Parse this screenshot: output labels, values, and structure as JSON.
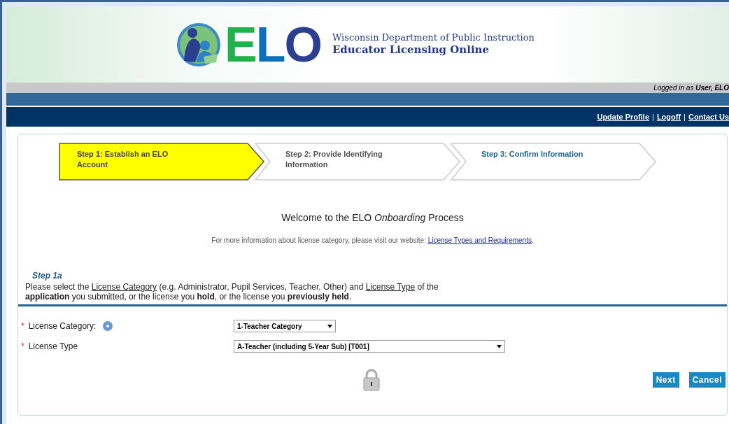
{
  "header": {
    "logo_text": "ELO",
    "org": "Wisconsin Department of Public Instruction",
    "app": "Educator Licensing Online"
  },
  "user_bar": {
    "text": "Logged in as **User, ELO**"
  },
  "nav_links": [
    {
      "label": "Update Profile"
    },
    {
      "label": "Logoff"
    },
    {
      "label": "Contact Us"
    }
  ],
  "nav_separator": "|",
  "steps": [
    {
      "label": "Step 1: Establish an ELO Account",
      "selected": true
    },
    {
      "label": "Step 2: Provide Identifying Information",
      "selected": false
    },
    {
      "label": "Step 3: Confirm Information",
      "selected": false
    }
  ],
  "welcome": "Welcome to the ELO *Onboarding* Process",
  "info": {
    "text": "For more information about license category, please visit our website: ",
    "link": "License Types and Requirements",
    "end": "."
  },
  "step_heading": "Step 1a",
  "instructions": [
    {
      "kind": "plain",
      "text": "Please select the "
    },
    {
      "kind": "underline",
      "text": "License Category"
    },
    {
      "kind": "plain",
      "text": " (e.g. Administrator, Pupil Services, Teacher, Other) and "
    },
    {
      "kind": "underline",
      "text": "License Type"
    },
    {
      "kind": "plain",
      "text": " of the "
    },
    {
      "kind": "break"
    },
    {
      "kind": "bold",
      "text": "application"
    },
    {
      "kind": "plain",
      "text": " you submitted, or the license you "
    },
    {
      "kind": "bold",
      "text": "hold"
    },
    {
      "kind": "plain",
      "text": ", or the license you "
    },
    {
      "kind": "bold",
      "text": "previously held"
    },
    {
      "kind": "plain",
      "text": "."
    }
  ],
  "fields": [
    {
      "label": "License Category:",
      "required_marker": "*",
      "help": true,
      "value": "1-Teacher Category"
    },
    {
      "label": "License Type",
      "required_marker": "*",
      "help": false,
      "value": "A-Teacher (including 5-Year Sub) [T001]"
    }
  ],
  "buttons": [
    {
      "label": "Next"
    },
    {
      "label": "Cancel"
    }
  ]
}
